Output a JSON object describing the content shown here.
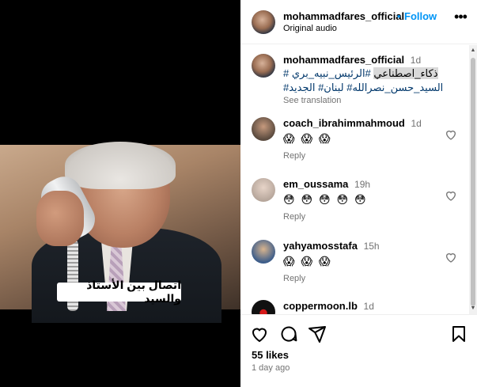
{
  "video": {
    "caption": "اتصال بين الأستاذ والسيد"
  },
  "header": {
    "username": "mohammadfares_official",
    "dot": "•",
    "follow_label": "Follow",
    "subtitle": "Original audio",
    "more_icon": "more-horizontal-icon"
  },
  "post": {
    "username": "mohammadfares_official",
    "time": "1d",
    "caption_plain": "ذكاء_اصطناعي",
    "caption_tags_line1": "#الرئيس_نبيه_بري #",
    "caption_tags_line2": "السيد_حسن_نصرالله# لبنان# الجديد#",
    "see_translation": "See translation"
  },
  "comments": [
    {
      "username": "coach_ibrahimmahmoud",
      "time": "1d",
      "emojis": "😱 😱 😱",
      "emoji_count": 3,
      "reply": "Reply"
    },
    {
      "username": "em_oussama",
      "time": "19h",
      "emojis": "😳 😳 😳 😳 😳",
      "emoji_count": 5,
      "reply": "Reply"
    },
    {
      "username": "yahyamosstafa",
      "time": "15h",
      "emojis": "😱 😱 😱",
      "emoji_count": 3,
      "reply": "Reply"
    },
    {
      "username": "coppermoon.lb",
      "time": "1d",
      "emojis": "",
      "reply": ""
    }
  ],
  "actions": {
    "like_icon": "heart-icon",
    "comment_icon": "comment-icon",
    "share_icon": "share-icon",
    "save_icon": "bookmark-icon"
  },
  "likes_text": "55 likes",
  "posted_ago": "1 day ago",
  "colors": {
    "link": "#0095f6",
    "hashtag": "#00376b",
    "muted": "#737373"
  }
}
